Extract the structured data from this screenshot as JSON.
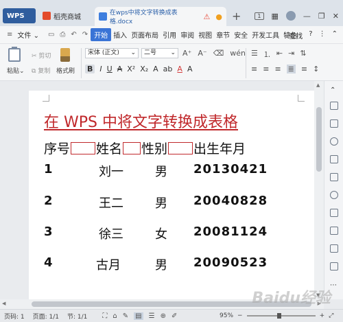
{
  "tabs": {
    "home": "WPS",
    "store": "稻壳商城",
    "document": "在wps中将文字转换成表格.docx",
    "new_tab": "+",
    "badge": "1"
  },
  "menu": {
    "file": "文件",
    "items": [
      "开始",
      "插入",
      "页面布局",
      "引用",
      "审阅",
      "视图",
      "章节",
      "安全",
      "开发工具",
      "特色"
    ],
    "search": "查找",
    "help": "?"
  },
  "ribbon": {
    "paste": "粘贴",
    "cut": "剪切",
    "copy": "复制",
    "format_painter": "格式刷",
    "font_name": "宋体 (正文)",
    "font_size": "二号"
  },
  "document": {
    "title": "在 WPS 中将文字转换成表格",
    "headers": [
      "序号",
      "姓名",
      "性别",
      "出生年月"
    ],
    "rows": [
      {
        "num": "1",
        "name": "刘一",
        "sex": "男",
        "birth": "20130421"
      },
      {
        "num": "2",
        "name": "王二",
        "sex": "男",
        "birth": "20040828"
      },
      {
        "num": "3",
        "name": "徐三",
        "sex": "女",
        "birth": "20081124"
      },
      {
        "num": "4",
        "name": "古月",
        "sex": "男",
        "birth": "20090523"
      }
    ]
  },
  "status": {
    "page_no": "页码: 1",
    "pages": "页面: 1/1",
    "section": "节: 1/1",
    "zoom": "95%"
  },
  "watermark": "Baidu经验",
  "colors": {
    "accent": "#3a74d6",
    "title_red": "#c0282b"
  }
}
